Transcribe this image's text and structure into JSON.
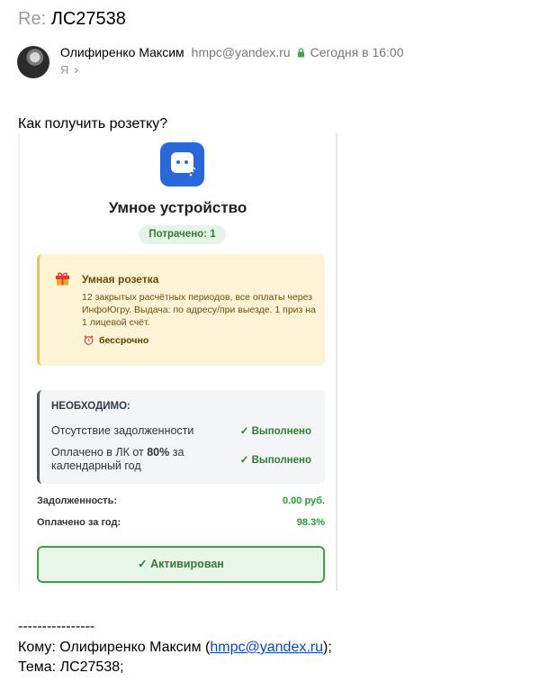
{
  "email": {
    "subject_prefix": "Re:",
    "subject": "ЛС27538",
    "sender_name": "Олифиренко Максим",
    "sender_email": "hmpc@yandex.ru",
    "date": "Сегодня в 16:00",
    "recipient": "Я",
    "question": "Как получить розетку?"
  },
  "card": {
    "title": "Умное устройство",
    "spent_badge": "Потрачено: 1",
    "prize": {
      "title": "Умная розетка",
      "description": "12 закрытых расчётных периодов, все оплаты через ИнфоЮгру. Выдача: по адресу/при выезде. 1 приз на 1 лицевой счёт.",
      "duration": "бессрочно"
    },
    "requirements": {
      "title": "НЕОБХОДИМО:",
      "items": [
        {
          "label": "Отсутствие задолженности",
          "status": "✓ Выполнено"
        },
        {
          "label_before": "Оплачено в ЛК от ",
          "label_bold": "80%",
          "label_after": " за календарный год",
          "status": "✓ Выполнено"
        }
      ]
    },
    "stats": [
      {
        "label": "Задолженность:",
        "value": "0.00 руб."
      },
      {
        "label": "Оплачено за год:",
        "value": "98.3%"
      }
    ],
    "activated_label": "✓ Активирован"
  },
  "footer": {
    "separator": "----------------",
    "to_label": "Кому: Олифиренко Максим (",
    "to_email": "hmpc@yandex.ru",
    "to_close": ");",
    "subject_line": "Тема: ЛС27538;"
  },
  "colors": {
    "accent_blue": "#2a67d9",
    "success_green": "#2e7d32",
    "warning_yellow": "#f5c04a",
    "link": "#0645c7"
  },
  "icons": {
    "app": "smart-device-icon",
    "gift": "gift-icon",
    "timer": "alarm-clock-icon",
    "lock": "lock-icon",
    "chevron": "chevron-right-icon"
  }
}
